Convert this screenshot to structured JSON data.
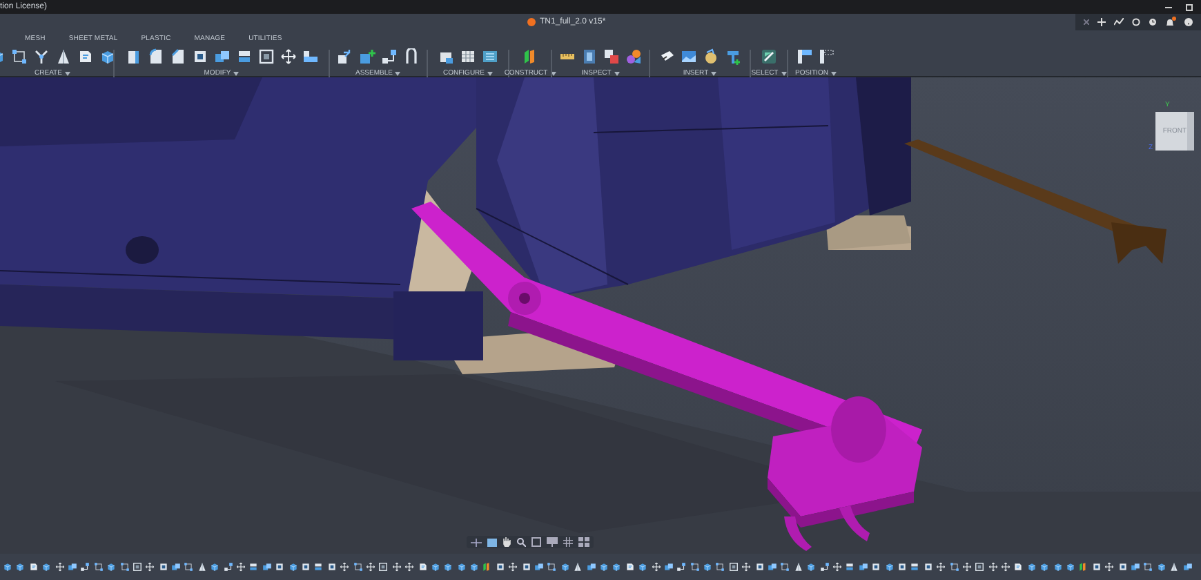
{
  "title_bar": {
    "text": "tion License)"
  },
  "document_tab": {
    "title": "TN1_full_2.0 v15*"
  },
  "header_tools": {
    "has_notification": true
  },
  "ribbon": {
    "tabs": [
      {
        "label": "MESH",
        "selected": false
      },
      {
        "label": "SHEET METAL",
        "selected": false
      },
      {
        "label": "PLASTIC",
        "selected": false
      },
      {
        "label": "MANAGE",
        "selected": false
      },
      {
        "label": "UTILITIES",
        "selected": false
      }
    ],
    "groups": [
      {
        "label": "CREATE"
      },
      {
        "label": "MODIFY"
      },
      {
        "label": "ASSEMBLE"
      },
      {
        "label": "CONFIGURE"
      },
      {
        "label": "CONSTRUCT"
      },
      {
        "label": "INSPECT"
      },
      {
        "label": "INSERT"
      },
      {
        "label": "SELECT"
      },
      {
        "label": "POSITION"
      }
    ]
  },
  "viewcube": {
    "face": "FRONT",
    "axis_y": "Y",
    "axis_z": "Z"
  }
}
